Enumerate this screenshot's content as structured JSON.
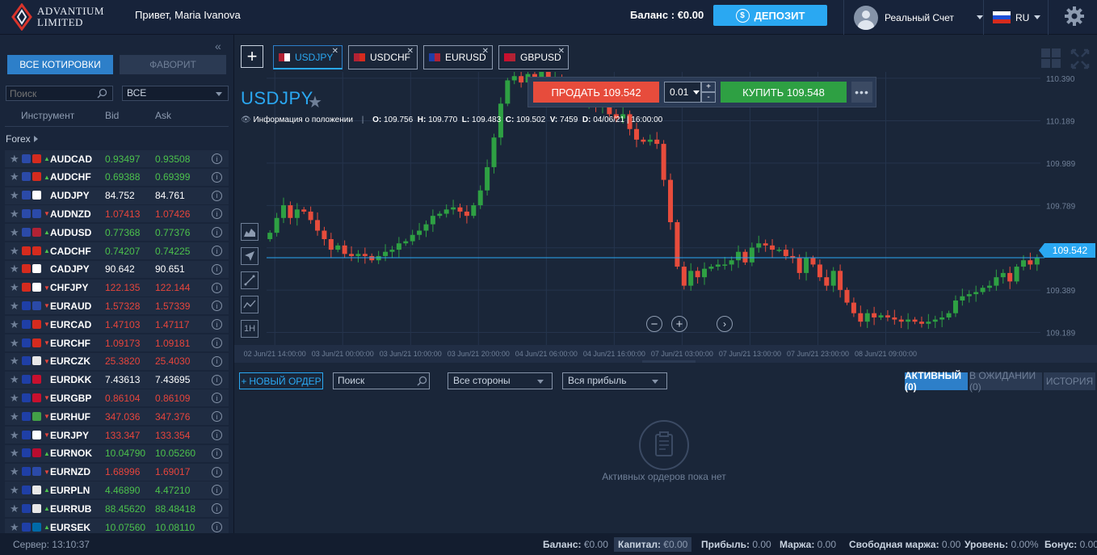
{
  "brand": {
    "line1": "ADVANTIUM",
    "line2": "LIMITED"
  },
  "header": {
    "greeting": "Привет, Maria Ivanova",
    "balance_label": "Баланс : €0.00",
    "deposit_label": "ДЕПОЗИТ",
    "account_label": "Реальный Счет",
    "language": "RU"
  },
  "sidebar": {
    "tab_all": "ВСЕ КОТИРОВКИ",
    "tab_fav": "ФАВОРИТ",
    "search_placeholder": "Поиск",
    "filter_value": "ВСЕ",
    "col_instrument": "Инструмент",
    "col_bid": "Bid",
    "col_ask": "Ask",
    "group": "Forex",
    "rows": [
      {
        "symbol": "AUDCAD",
        "bid": "0.93497",
        "ask": "0.93508",
        "dir": "up",
        "c1": "#2b4aa8",
        "c2": "#d52b1e"
      },
      {
        "symbol": "AUDCHF",
        "bid": "0.69388",
        "ask": "0.69399",
        "dir": "up",
        "c1": "#2b4aa8",
        "c2": "#d52b1e"
      },
      {
        "symbol": "AUDJPY",
        "bid": "84.752",
        "ask": "84.761",
        "dir": "flat",
        "c1": "#2b4aa8",
        "c2": "#ffffff"
      },
      {
        "symbol": "AUDNZD",
        "bid": "1.07413",
        "ask": "1.07426",
        "dir": "down",
        "c1": "#2b4aa8",
        "c2": "#2b4aa8"
      },
      {
        "symbol": "AUDUSD",
        "bid": "0.77368",
        "ask": "0.77376",
        "dir": "up",
        "c1": "#2b4aa8",
        "c2": "#b22234"
      },
      {
        "symbol": "CADCHF",
        "bid": "0.74207",
        "ask": "0.74225",
        "dir": "up",
        "c1": "#d52b1e",
        "c2": "#d52b1e"
      },
      {
        "symbol": "CADJPY",
        "bid": "90.642",
        "ask": "90.651",
        "dir": "flat",
        "c1": "#d52b1e",
        "c2": "#ffffff"
      },
      {
        "symbol": "CHFJPY",
        "bid": "122.135",
        "ask": "122.144",
        "dir": "down",
        "c1": "#d52b1e",
        "c2": "#ffffff"
      },
      {
        "symbol": "EURAUD",
        "bid": "1.57328",
        "ask": "1.57339",
        "dir": "down",
        "c1": "#1f3fa6",
        "c2": "#2b4aa8"
      },
      {
        "symbol": "EURCAD",
        "bid": "1.47103",
        "ask": "1.47117",
        "dir": "down",
        "c1": "#1f3fa6",
        "c2": "#d52b1e"
      },
      {
        "symbol": "EURCHF",
        "bid": "1.09173",
        "ask": "1.09181",
        "dir": "down",
        "c1": "#1f3fa6",
        "c2": "#d52b1e"
      },
      {
        "symbol": "EURCZK",
        "bid": "25.3820",
        "ask": "25.4030",
        "dir": "down",
        "c1": "#1f3fa6",
        "c2": "#e8e8e8"
      },
      {
        "symbol": "EURDKK",
        "bid": "7.43613",
        "ask": "7.43695",
        "dir": "flat",
        "c1": "#1f3fa6",
        "c2": "#c8102e"
      },
      {
        "symbol": "EURGBP",
        "bid": "0.86104",
        "ask": "0.86109",
        "dir": "down",
        "c1": "#1f3fa6",
        "c2": "#c8102e"
      },
      {
        "symbol": "EURHUF",
        "bid": "347.036",
        "ask": "347.376",
        "dir": "down",
        "c1": "#1f3fa6",
        "c2": "#43a047"
      },
      {
        "symbol": "EURJPY",
        "bid": "133.347",
        "ask": "133.354",
        "dir": "down",
        "c1": "#1f3fa6",
        "c2": "#ffffff"
      },
      {
        "symbol": "EURNOK",
        "bid": "10.04790",
        "ask": "10.05260",
        "dir": "up",
        "c1": "#1f3fa6",
        "c2": "#ba0c2f"
      },
      {
        "symbol": "EURNZD",
        "bid": "1.68996",
        "ask": "1.69017",
        "dir": "down",
        "c1": "#1f3fa6",
        "c2": "#2b4aa8"
      },
      {
        "symbol": "EURPLN",
        "bid": "4.46890",
        "ask": "4.47210",
        "dir": "up",
        "c1": "#1f3fa6",
        "c2": "#e8e8e8"
      },
      {
        "symbol": "EURRUB",
        "bid": "88.45620",
        "ask": "88.48418",
        "dir": "up",
        "c1": "#1f3fa6",
        "c2": "#e8e8e8"
      },
      {
        "symbol": "EURSEK",
        "bid": "10.07560",
        "ask": "10.08110",
        "dir": "up",
        "c1": "#1f3fa6",
        "c2": "#006aa7"
      }
    ]
  },
  "tabs": [
    {
      "label": "USDJPY",
      "active": true,
      "c1": "#b22234",
      "c2": "#ffffff"
    },
    {
      "label": "USDCHF",
      "active": false,
      "c1": "#b22234",
      "c2": "#d52b1e"
    },
    {
      "label": "EURUSD",
      "active": false,
      "c1": "#1f3fa6",
      "c2": "#b22234"
    },
    {
      "label": "GBPUSD",
      "active": false,
      "c1": "#c8102e",
      "c2": "#b22234"
    }
  ],
  "chart": {
    "symbol": "USDJPY",
    "info_label": "Информация о положении",
    "ohlc": {
      "o": "109.756",
      "h": "109.770",
      "l": "109.483",
      "c": "109.502",
      "v": "7459",
      "d": "04/06/21 | 16:00:00"
    },
    "sell_label": "ПРОДАТЬ 109.542",
    "buy_label": "КУПИТЬ 109.548",
    "qty": "0.01",
    "current_price": "109.542",
    "timeframe": "1H"
  },
  "chart_data": {
    "type": "candlestick",
    "y_ticks": [
      "110.390",
      "110.189",
      "109.989",
      "109.789",
      "109.589",
      "109.389",
      "109.189"
    ],
    "x_ticks": [
      "02 Jun/21 14:00:00",
      "03 Jun/21 00:00:00",
      "03 Jun/21 10:00:00",
      "03 Jun/21 20:00:00",
      "04 Jun/21 06:00:00",
      "04 Jun/21 16:00:00",
      "07 Jun/21 03:00:00",
      "07 Jun/21 13:00:00",
      "07 Jun/21 23:00:00",
      "08 Jun/21 09:00:00"
    ],
    "ylim": [
      109.13,
      110.42
    ],
    "current": 109.542,
    "closes": [
      109.66,
      109.73,
      109.79,
      109.73,
      109.77,
      109.76,
      109.72,
      109.67,
      109.63,
      109.58,
      109.6,
      109.56,
      109.55,
      109.56,
      109.55,
      109.53,
      109.55,
      109.57,
      109.58,
      109.61,
      109.62,
      109.65,
      109.67,
      109.7,
      109.74,
      109.75,
      109.77,
      109.78,
      109.76,
      109.74,
      109.79,
      109.86,
      109.97,
      110.11,
      110.27,
      110.38,
      110.4,
      110.37,
      110.41,
      110.34,
      110.42,
      110.36,
      110.39,
      110.35,
      110.3,
      110.37,
      110.27,
      110.31,
      110.26,
      110.29,
      110.22,
      110.2,
      110.22,
      110.15,
      110.1,
      110.09,
      110.1,
      110.08,
      109.91,
      109.71,
      109.5,
      109.41,
      109.48,
      109.45,
      109.49,
      109.5,
      109.51,
      109.51,
      109.53,
      109.57,
      109.52,
      109.59,
      109.61,
      109.6,
      109.58,
      109.58,
      109.55,
      109.54,
      109.47,
      109.54,
      109.51,
      109.45,
      109.41,
      109.48,
      109.39,
      109.33,
      109.28,
      109.24,
      109.28,
      109.26,
      109.27,
      109.26,
      109.25,
      109.24,
      109.25,
      109.24,
      109.23,
      109.24,
      109.25,
      109.26,
      109.28,
      109.34,
      109.36,
      109.37,
      109.38,
      109.4,
      109.41,
      109.45,
      109.47,
      109.43,
      109.5,
      109.53,
      109.51,
      109.54
    ]
  },
  "orders": {
    "new_order": "НОВЫЙ ОРДЕР",
    "search_placeholder": "Поиск",
    "sides": "Все стороны",
    "profit": "Вся прибыль",
    "tab_active": "АКТИВНЫЙ (0)",
    "tab_pending": "В ОЖИДАНИИ (0)",
    "tab_history": "ИСТОРИЯ",
    "empty": "Активных ордеров пока нет"
  },
  "footer": {
    "server": "Сервер: 13:10:37",
    "balance": "Баланс:",
    "balance_v": "€0.00",
    "capital": "Капитал:",
    "capital_v": "€0.00",
    "profit": "Прибыль:",
    "profit_v": "0.00",
    "margin": "Маржа:",
    "margin_v": "0.00",
    "free_margin": "Свободная маржа:",
    "free_margin_v": "0.00",
    "level": "Уровень:",
    "level_v": "0.00%",
    "bonus": "Бонус:",
    "bonus_v": "0.00"
  }
}
